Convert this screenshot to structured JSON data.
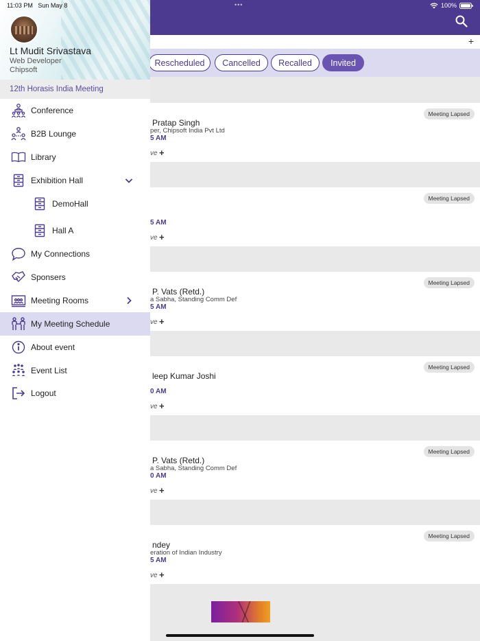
{
  "status": {
    "time": "11:03 PM",
    "date": "Sun May 8",
    "battery": "100%"
  },
  "filters": [
    {
      "label": "Rescheduled"
    },
    {
      "label": "Cancelled"
    },
    {
      "label": "Recalled"
    },
    {
      "label": "Invited",
      "active": true
    }
  ],
  "meetings": [
    {
      "name": "Pratap Singh",
      "org": "per, Chipsoft India Pvt Ltd",
      "time": "5 AM",
      "action": "ve",
      "badge": "Meeting Lapsed"
    },
    {
      "name": "",
      "org": "",
      "time": "5 AM",
      "action": "ve",
      "badge": "Meeting Lapsed"
    },
    {
      "name": "P. Vats (Retd.)",
      "org": "a Sabha, Standing Comm Def",
      "time": "5 AM",
      "action": "ve",
      "badge": "Meeting Lapsed"
    },
    {
      "name": "leep Kumar Joshi",
      "org": "",
      "time": "0 AM",
      "action": "ve",
      "badge": "Meeting Lapsed"
    },
    {
      "name": "P. Vats (Retd.)",
      "org": "a Sabha, Standing Comm Def",
      "time": "0 AM",
      "action": "ve",
      "badge": "Meeting Lapsed"
    },
    {
      "name": "ndey",
      "org": "eration of Indian Industry",
      "time": "5 AM",
      "action": "ve",
      "badge": "Meeting Lapsed"
    }
  ],
  "profile": {
    "name": "Lt Mudit Srivastava",
    "role": "Web Developer",
    "company": "Chipsoft"
  },
  "event_title": "12th Horasis India Meeting",
  "menu": [
    {
      "label": "Conference",
      "icon": "conference-icon"
    },
    {
      "label": "B2B Lounge",
      "icon": "b2b-lounge-icon"
    },
    {
      "label": "Library",
      "icon": "book-icon"
    },
    {
      "label": "Exhibition Hall",
      "icon": "exhibition-icon",
      "expanded": true
    },
    {
      "label": "DemoHall",
      "icon": "hall-icon",
      "sub": true
    },
    {
      "label": "Hall A",
      "icon": "hall-icon",
      "sub": true
    },
    {
      "label": "My Connections",
      "icon": "chat-icon"
    },
    {
      "label": "Sponsers",
      "icon": "handshake-icon"
    },
    {
      "label": "Meeting Rooms",
      "icon": "meeting-room-icon",
      "has_chevron": true
    },
    {
      "label": "My Meeting Schedule",
      "icon": "schedule-icon",
      "active": true
    },
    {
      "label": "About event",
      "icon": "info-icon"
    },
    {
      "label": "Event List",
      "icon": "people-icon"
    },
    {
      "label": "Logout",
      "icon": "logout-icon"
    }
  ],
  "colors": {
    "primary": "#4b3a8f",
    "accent": "#6a54b2",
    "highlight": "#dcdaf0"
  }
}
